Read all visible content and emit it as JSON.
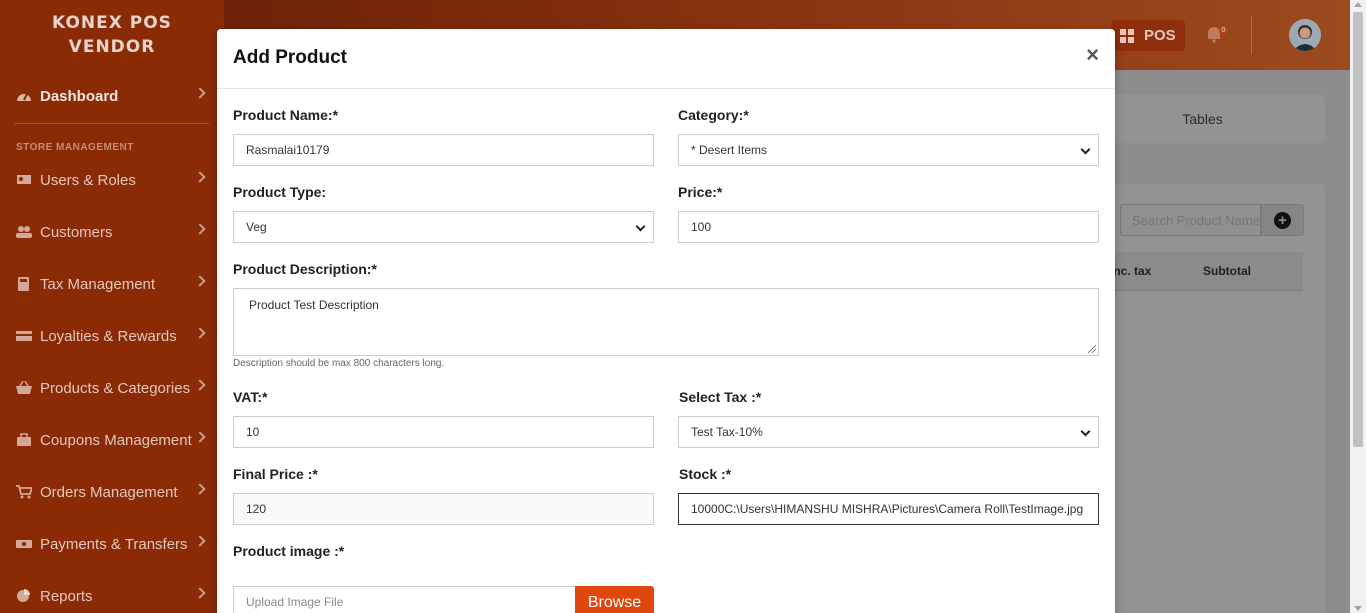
{
  "brand": {
    "line1": "KONEX POS",
    "line2": "VENDOR"
  },
  "sidebar": {
    "section_label": "STORE MANAGEMENT",
    "items": [
      {
        "label": "Dashboard",
        "icon": "dashboard-icon"
      },
      {
        "label": "Users & Roles",
        "icon": "users-roles-icon"
      },
      {
        "label": "Customers",
        "icon": "customers-icon"
      },
      {
        "label": "Tax Management",
        "icon": "calculator-icon"
      },
      {
        "label": "Loyalties & Rewards",
        "icon": "card-icon"
      },
      {
        "label": "Products & Categories",
        "icon": "basket-icon"
      },
      {
        "label": "Coupons Management",
        "icon": "briefcase-icon"
      },
      {
        "label": "Orders Management",
        "icon": "cart-icon"
      },
      {
        "label": "Payments & Transfers",
        "icon": "money-icon"
      },
      {
        "label": "Reports",
        "icon": "pie-chart-icon"
      }
    ]
  },
  "topbar": {
    "pos_label": "POS",
    "notification_count": "0"
  },
  "background": {
    "tables_tab": "Tables",
    "search_placeholder": "Search Product Name",
    "columns": [
      "e inc. tax",
      "Subtotal"
    ]
  },
  "modal": {
    "title": "Add Product",
    "close": "×",
    "product_name": {
      "label": "Product Name:*",
      "value": "Rasmalai10179"
    },
    "category": {
      "label": "Category:*",
      "value": "* Desert Items"
    },
    "product_type": {
      "label": "Product Type:",
      "value": "Veg"
    },
    "price": {
      "label": "Price:*",
      "value": "100"
    },
    "description": {
      "label": "Product Description:*",
      "value": "Product Test Description",
      "help": "Description should be max 800 characters long."
    },
    "vat": {
      "label": "VAT:*",
      "value": "10"
    },
    "select_tax": {
      "label": "Select Tax :*",
      "value": "Test Tax-10%"
    },
    "final_price": {
      "label": "Final Price :*",
      "value": "120"
    },
    "stock": {
      "label": "Stock :*",
      "value": "10000C:\\Users\\HIMANSHU MISHRA\\Pictures\\Camera Roll\\TestImage.jpg"
    },
    "product_image": {
      "label": "Product image :*",
      "placeholder": "Upload Image File",
      "browse": "Browse"
    }
  },
  "colors": {
    "sidebar": "#8a2b06",
    "accent": "#e0470f"
  }
}
